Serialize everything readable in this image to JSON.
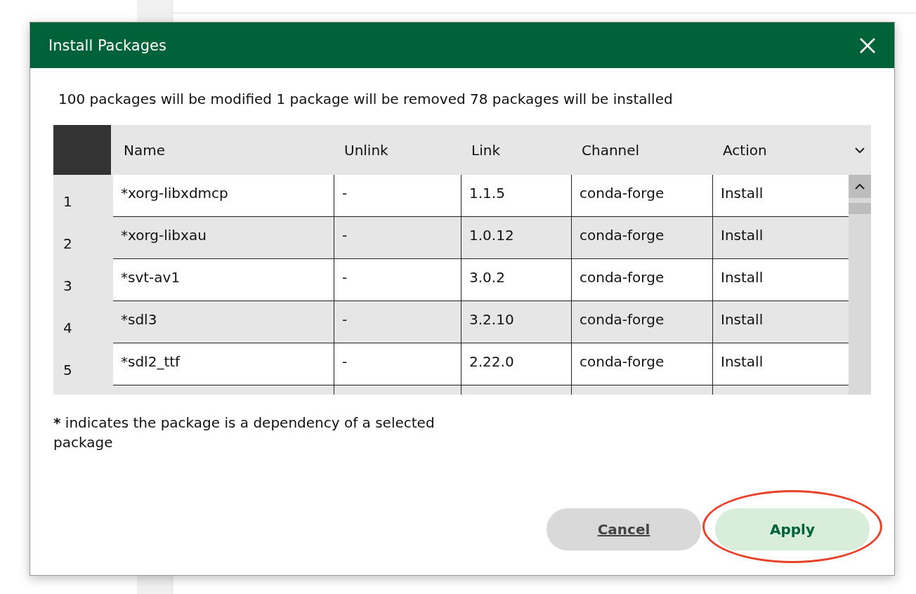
{
  "dialog": {
    "title": "Install Packages"
  },
  "summary": "100 packages will be modified 1 package will be removed 78 packages will be installed",
  "table": {
    "columns": [
      "Name",
      "Unlink",
      "Link",
      "Channel",
      "Action"
    ],
    "rows": [
      {
        "index": "1",
        "cells": [
          "*xorg-libxdmcp",
          "-",
          "1.1.5",
          "conda-forge",
          "Install"
        ]
      },
      {
        "index": "2",
        "cells": [
          "*xorg-libxau",
          "-",
          "1.0.12",
          "conda-forge",
          "Install"
        ]
      },
      {
        "index": "3",
        "cells": [
          "*svt-av1",
          "-",
          "3.0.2",
          "conda-forge",
          "Install"
        ]
      },
      {
        "index": "4",
        "cells": [
          "*sdl3",
          "-",
          "3.2.10",
          "conda-forge",
          "Install"
        ]
      },
      {
        "index": "5",
        "cells": [
          "*sdl2_ttf",
          "-",
          "2.22.0",
          "conda-forge",
          "Install"
        ]
      }
    ]
  },
  "footnote": {
    "mark": "*",
    "text": " indicates the package is a dependency of a selected package"
  },
  "buttons": [
    {
      "label": "Cancel",
      "kind": "secondary",
      "highlighted": false
    },
    {
      "label": "Apply",
      "kind": "primary",
      "highlighted": true
    }
  ]
}
